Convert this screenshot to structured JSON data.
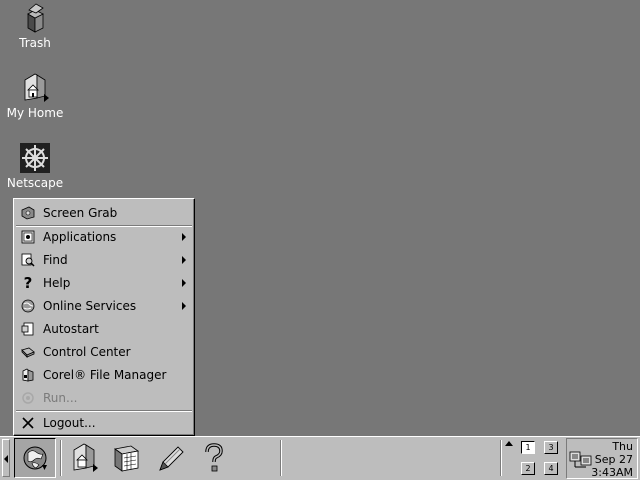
{
  "desktop": {
    "icons": [
      {
        "label": "Trash",
        "icon": "trash-icon"
      },
      {
        "label": "My Home",
        "icon": "home-folder-icon"
      },
      {
        "label": "Netscape",
        "icon": "netscape-wheel-icon"
      }
    ]
  },
  "start_menu": {
    "items": [
      {
        "label": "Screen Grab",
        "icon": "camera-icon",
        "submenu": false
      },
      {
        "label": "Applications",
        "icon": "applications-icon",
        "submenu": true
      },
      {
        "label": "Find",
        "icon": "find-icon",
        "submenu": true
      },
      {
        "label": "Help",
        "icon": "question-icon",
        "submenu": true
      },
      {
        "label": "Online Services",
        "icon": "globe-icon",
        "submenu": true
      },
      {
        "label": "Autostart",
        "icon": "autostart-icon",
        "submenu": false
      },
      {
        "label": "Control Center",
        "icon": "control-center-icon",
        "submenu": false
      },
      {
        "label": "Corel® File Manager",
        "icon": "file-manager-icon",
        "submenu": false
      },
      {
        "label": "Run...",
        "icon": "run-icon",
        "submenu": false,
        "disabled": true
      },
      {
        "label": "Logout...",
        "icon": "logout-icon",
        "submenu": false
      }
    ]
  },
  "taskbar": {
    "launchers": [
      "home-folder-icon",
      "calendar-icon",
      "pencil-icon",
      "question-icon"
    ],
    "virtual_desktops": [
      "1",
      "2",
      "3",
      "4"
    ],
    "active_desktop": "1",
    "clock": {
      "day": "Thu",
      "date": "Sep 27",
      "time": "3:43AM"
    }
  },
  "colors": {
    "desktop": "#777777",
    "panel": "#bdbdbd",
    "desktop_text": "#ffffff"
  }
}
